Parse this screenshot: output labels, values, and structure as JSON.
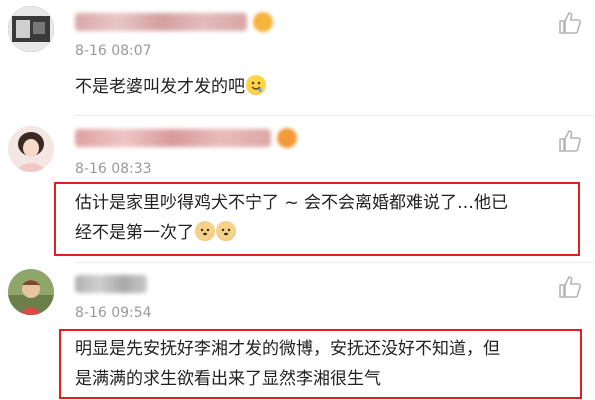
{
  "comments": [
    {
      "timestamp": "8-16 08:07",
      "text": "不是老婆叫发才发的吧",
      "emoji": "drooling-face-emoji"
    },
    {
      "timestamp": "8-16 08:33",
      "text_line1": "估计是家里吵得鸡犬不宁了 ~ 会不会离婚都难说了…他已",
      "text_line2": "经不是第一次了",
      "emoji": "doge-emoji"
    },
    {
      "timestamp": "8-16 09:54",
      "text_line1": "明显是先安抚好李湘才发的微博，安抚还没好不知道，但",
      "text_line2": "是满满的求生欲看出来了显然李湘很生气"
    }
  ],
  "colors": {
    "highlight_border": "#e02020",
    "timestamp": "#9a9a9a",
    "text": "#222222",
    "icon": "#b5b5b5"
  }
}
